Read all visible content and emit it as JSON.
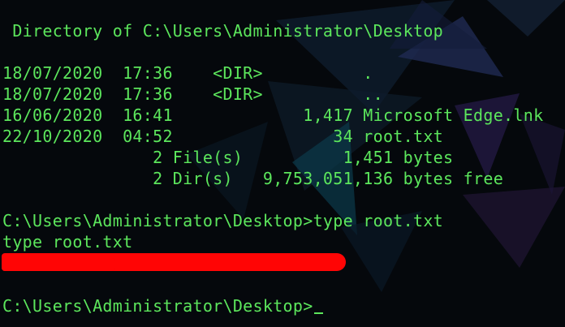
{
  "terminal": {
    "lines": [
      " Directory of C:\\Users\\Administrator\\Desktop",
      "",
      "18/07/2020  17:36    <DIR>          .",
      "18/07/2020  17:36    <DIR>          ..",
      "16/06/2020  16:41             1,417 Microsoft Edge.lnk",
      "22/10/2020  04:52                34 root.txt",
      "               2 File(s)          1,451 bytes",
      "               2 Dir(s)   9,753,051,136 bytes free",
      "",
      "C:\\Users\\Administrator\\Desktop>type root.txt",
      "type root.txt",
      "",
      "",
      "C:\\Users\\Administrator\\Desktop>"
    ],
    "text_color": "#5ce65c",
    "redaction_color": "#ff0505"
  }
}
